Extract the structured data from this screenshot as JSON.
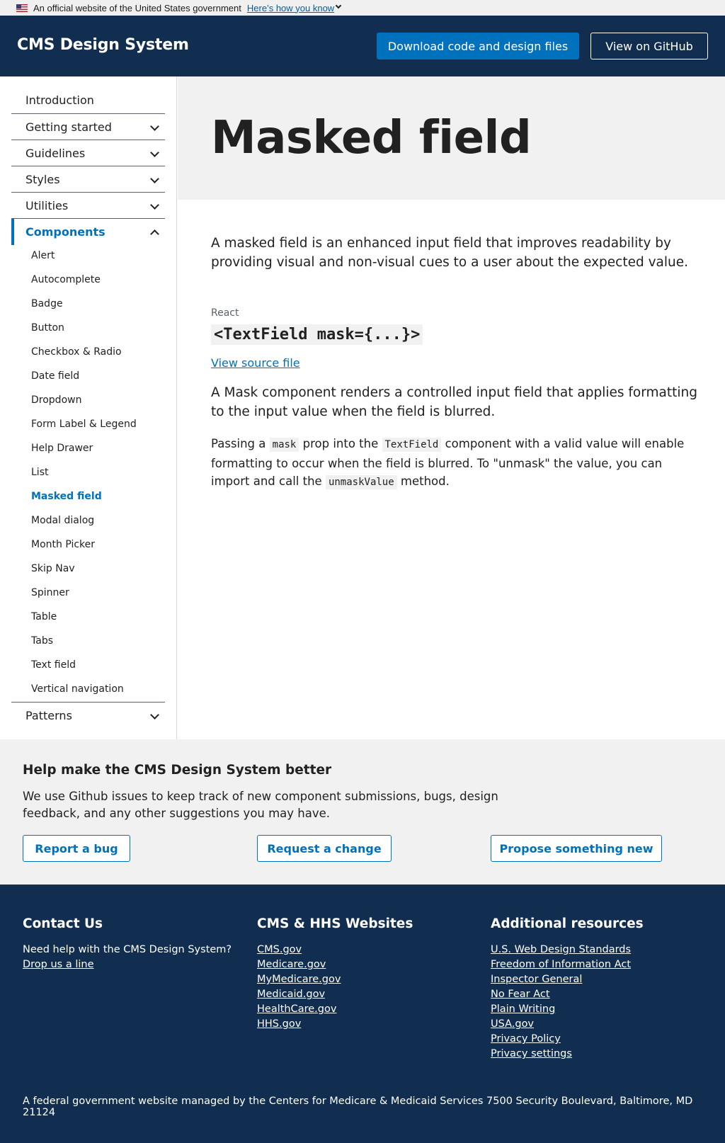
{
  "gov_banner": {
    "text": "An official website of the United States government",
    "link": "Here’s how you know"
  },
  "header": {
    "title": "CMS Design System",
    "download_label": "Download code and design files",
    "github_label": "View on GitHub"
  },
  "sidebar": {
    "top_items": [
      {
        "label": "Introduction"
      },
      {
        "label": "Getting started"
      },
      {
        "label": "Guidelines"
      },
      {
        "label": "Styles"
      },
      {
        "label": "Utilities"
      },
      {
        "label": "Components"
      },
      {
        "label": "Patterns"
      }
    ],
    "components": [
      "Alert",
      "Autocomplete",
      "Badge",
      "Button",
      "Checkbox & Radio",
      "Date field",
      "Dropdown",
      "Form Label & Legend",
      "Help Drawer",
      "List",
      "Masked field",
      "Modal dialog",
      "Month Picker",
      "Skip Nav",
      "Spinner",
      "Table",
      "Tabs",
      "Text field",
      "Vertical navigation"
    ],
    "current": "Masked field"
  },
  "main": {
    "title": "Masked field",
    "lead": "A masked field is an enhanced input field that improves readability by providing visual and non-visual cues to a user about the expected value.",
    "react_label": "React",
    "code_title": "<TextField mask={...}>",
    "source_link": "View source file",
    "para1": "A Mask component renders a controlled input field that applies formatting to the input value when the field is blurred.",
    "para2": {
      "t1": "Passing a ",
      "c1": "mask",
      "t2": " prop into the ",
      "c2": "TextField",
      "t3": " component with a valid value will enable formatting to occur when the field is blurred. To \"unmask\" the value, you can import and call the ",
      "c3": "unmaskValue",
      "t4": " method."
    }
  },
  "help": {
    "title": "Help make the CMS Design System better",
    "text": "We use Github issues to keep track of new component submissions, bugs, design feedback, and any other suggestions you may have.",
    "buttons": [
      "Report a bug",
      "Request a change",
      "Propose something new"
    ]
  },
  "footer": {
    "contact": {
      "title": "Contact Us",
      "text": "Need help with the CMS Design System?",
      "link": "Drop us a line"
    },
    "websites": {
      "title": "CMS & HHS Websites",
      "links": [
        "CMS.gov",
        "Medicare.gov",
        "MyMedicare.gov",
        "Medicaid.gov",
        "HealthCare.gov",
        "HHS.gov"
      ]
    },
    "resources": {
      "title": "Additional resources",
      "links": [
        "U.S. Web Design Standards",
        "Freedom of Information Act",
        "Inspector General",
        "No Fear Act",
        "Plain Writing",
        "USA.gov",
        "Privacy Policy",
        "Privacy settings"
      ]
    },
    "bottom": "A federal government website managed by the Centers for Medicare & Medicaid Services 7500 Security Boulevard, Baltimore, MD 21124"
  },
  "colors": {
    "navy": "#112e51",
    "primary": "#0071bc",
    "gray_bg": "#f1f1f1"
  }
}
